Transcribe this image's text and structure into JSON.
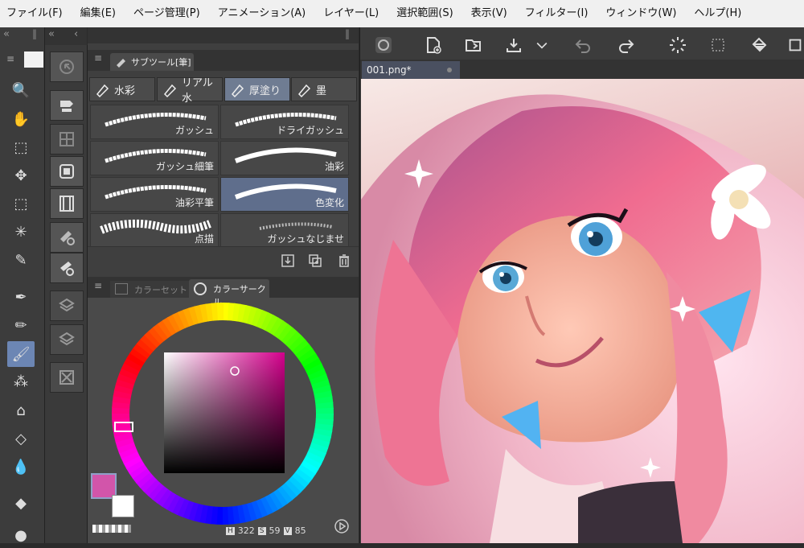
{
  "menu": [
    "ファイル(F)",
    "編集(E)",
    "ページ管理(P)",
    "アニメーション(A)",
    "レイヤー(L)",
    "選択範囲(S)",
    "表示(V)",
    "フィルター(I)",
    "ウィンドウ(W)",
    "ヘルプ(H)"
  ],
  "tools": [
    {
      "name": "zoom-icon",
      "glyph": "🔍"
    },
    {
      "name": "hand-icon",
      "glyph": "✋"
    },
    {
      "name": "object-select-icon",
      "glyph": "⬚"
    },
    {
      "name": "move-icon",
      "glyph": "✥"
    },
    {
      "name": "marquee-icon",
      "glyph": "⬚"
    },
    {
      "name": "magic-wand-icon",
      "glyph": "✳"
    },
    {
      "name": "eyedropper-icon",
      "glyph": "✎"
    },
    {
      "name": "pen-icon",
      "glyph": "✒"
    },
    {
      "name": "pencil-icon",
      "glyph": "✏"
    },
    {
      "name": "paint-brush-icon",
      "glyph": "🖌"
    },
    {
      "name": "airbrush-icon",
      "glyph": "⁂"
    },
    {
      "name": "decoration-icon",
      "glyph": "⌂"
    },
    {
      "name": "eraser-icon",
      "glyph": "◇"
    },
    {
      "name": "blend-icon",
      "glyph": "💧"
    },
    {
      "name": "fill-icon",
      "glyph": "◆"
    },
    {
      "name": "gradient-icon",
      "glyph": "●"
    }
  ],
  "subtool_panel": {
    "title": "サブツール[筆]",
    "tabs": [
      "水彩",
      "リアル水",
      "厚塗り",
      "墨"
    ],
    "active_tab": 2,
    "brushes": [
      {
        "label": "ガッシュ",
        "selected": false
      },
      {
        "label": "ドライガッシュ",
        "selected": false
      },
      {
        "label": "ガッシュ細筆",
        "selected": false
      },
      {
        "label": "油彩",
        "selected": false
      },
      {
        "label": "油彩平筆",
        "selected": false
      },
      {
        "label": "色変化",
        "selected": true
      },
      {
        "label": "点描",
        "selected": false
      },
      {
        "label": "ガッシュなじませ",
        "selected": false
      }
    ]
  },
  "color_panel": {
    "tab_inactive": "カラーセット",
    "tab_active": "カラーサークル",
    "h_label": "H",
    "h_value": "322",
    "s_label": "S",
    "s_value": "59",
    "v_label": "V",
    "v_value": "85",
    "main_color": "#d255aa",
    "sub_color": "#ffffff"
  },
  "canvas": {
    "document_tab": "001.png*"
  }
}
